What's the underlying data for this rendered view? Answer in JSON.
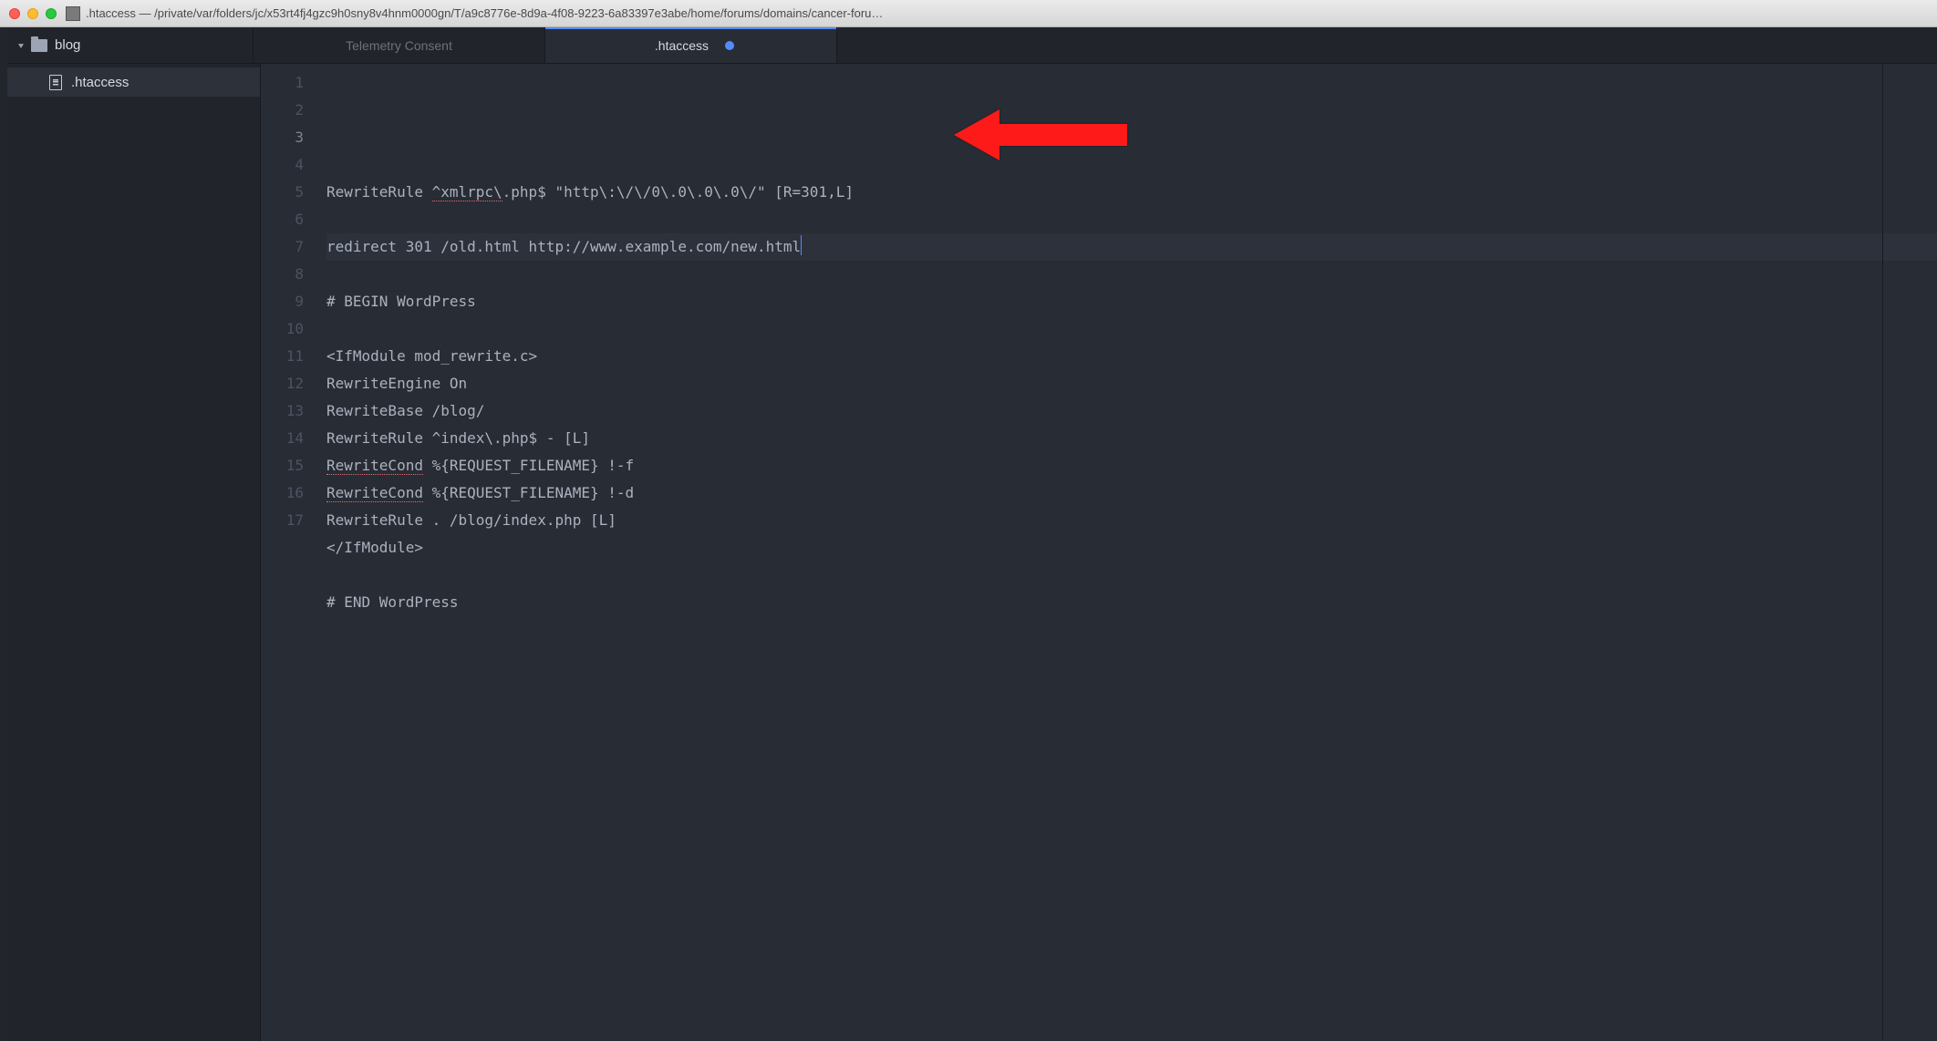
{
  "window": {
    "title": ".htaccess — /private/var/folders/jc/x53rt4fj4gzc9h0sny8v4hnm0000gn/T/a9c8776e-8d9a-4f08-9223-6a83397e3abe/home/forums/domains/cancer-foru…"
  },
  "project": {
    "root_name": "blog"
  },
  "tabs": [
    {
      "label": "Telemetry Consent",
      "active": false,
      "dirty": false
    },
    {
      "label": ".htaccess",
      "active": true,
      "dirty": true
    }
  ],
  "tree": {
    "file_name": ".htaccess"
  },
  "editor": {
    "active_line": 3,
    "lines": [
      {
        "n": 1,
        "text": "RewriteRule ^xmlrpc\\.php$ \"http\\:\\/\\/0\\.0\\.0\\.0\\/\" [R=301,L]",
        "spell_ranges": [
          [
            12,
            20
          ]
        ]
      },
      {
        "n": 2,
        "text": ""
      },
      {
        "n": 3,
        "text": "redirect 301 /old.html http://www.example.com/new.html"
      },
      {
        "n": 4,
        "text": ""
      },
      {
        "n": 5,
        "text": "# BEGIN WordPress"
      },
      {
        "n": 6,
        "text": ""
      },
      {
        "n": 7,
        "text": "<IfModule mod_rewrite.c>"
      },
      {
        "n": 8,
        "text": "RewriteEngine On"
      },
      {
        "n": 9,
        "text": "RewriteBase /blog/"
      },
      {
        "n": 10,
        "text": "RewriteRule ^index\\.php$ - [L]"
      },
      {
        "n": 11,
        "text": "RewriteCond %{REQUEST_FILENAME} !-f",
        "spell_ranges": [
          [
            0,
            11
          ]
        ]
      },
      {
        "n": 12,
        "text": "RewriteCond %{REQUEST_FILENAME} !-d",
        "spell_ranges": [
          [
            0,
            11
          ]
        ]
      },
      {
        "n": 13,
        "text": "RewriteRule . /blog/index.php [L]"
      },
      {
        "n": 14,
        "text": "</IfModule>"
      },
      {
        "n": 15,
        "text": ""
      },
      {
        "n": 16,
        "text": "# END WordPress"
      },
      {
        "n": 17,
        "text": ""
      }
    ]
  },
  "annotation": {
    "kind": "arrow",
    "color": "#ff1a1a",
    "points_to_line": 3
  }
}
